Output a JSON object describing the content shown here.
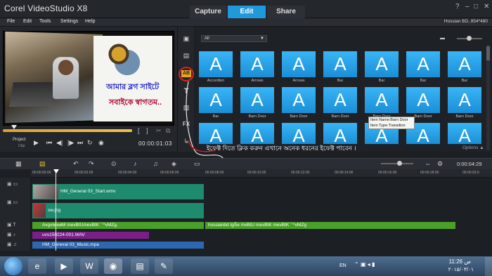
{
  "app": {
    "title": "Corel VideoStudio X8"
  },
  "tabs": [
    {
      "label": "Capture"
    },
    {
      "label": "Edit"
    },
    {
      "label": "Share"
    }
  ],
  "window_buttons": {
    "help": "?",
    "minimize": "–",
    "maximize": "□",
    "close": "✕"
  },
  "menu": [
    {
      "label": "File"
    },
    {
      "label": "Edit"
    },
    {
      "label": "Tools"
    },
    {
      "label": "Settings"
    },
    {
      "label": "Help"
    }
  ],
  "project_info": "Hossian BD, 854*480",
  "preview": {
    "overlay_line1": "আমার ব্লগ সাইটে",
    "overlay_line2": "সবাইকে স্বাগতম..",
    "project_label": "Project",
    "clip_label": "Clip",
    "timecode": "00:00:01:03",
    "progress": 1.0,
    "trim_start": "[",
    "trim_end": "]"
  },
  "library": {
    "category": "All",
    "transitions": [
      {
        "label": "Accordion"
      },
      {
        "label": "Arrows"
      },
      {
        "label": "Arrows"
      },
      {
        "label": "Bar"
      },
      {
        "label": "Bar"
      },
      {
        "label": "Bar"
      },
      {
        "label": "Bar"
      },
      {
        "label": "Bar"
      },
      {
        "label": "Barn Door"
      },
      {
        "label": "Barn Door"
      },
      {
        "label": "Barn Door"
      },
      {
        "label": "Barn Door"
      },
      {
        "label": "Barn Door"
      },
      {
        "label": "Barn Door"
      },
      {
        "label": ""
      },
      {
        "label": ""
      },
      {
        "label": ""
      },
      {
        "label": ""
      },
      {
        "label": ""
      },
      {
        "label": ""
      },
      {
        "label": ""
      }
    ],
    "thumb_glyph": "A",
    "tooltip_name": "Item Name:Barn Door",
    "tooltip_type": "Item Type:Transition",
    "options_label": "Options ▲"
  },
  "annotation": "ইফেক্ট দিতে ক্লিক করুন এখানে অনেক ধরনের ইফেক্ট পাবেন ।",
  "timeline": {
    "timecode": "0:00:04:29",
    "ticks": [
      "00:00:00:00",
      "00:00:02:00",
      "00:00:04:00",
      "00:00:06:00",
      "00:00:08:00",
      "00:00:10:00",
      "00:00:12:00",
      "00:00:14:00",
      "00:00:16:00",
      "00:00:18:00",
      "00:00:20:0"
    ],
    "clips": {
      "video": "HM_General 03_Start.wmv",
      "overlay": "sw.jpg",
      "title1": "AvgviweøM mevBtUmevBtK ¯^vMZg.",
      "title2": "hossianbd IgŠe mvBtU mevBtK mevBtK ¯^vMZg",
      "voice": "uvs150224-001.WAV",
      "music": "HM_General 03_Music.mpa"
    }
  },
  "taskbar": {
    "lang": "EN",
    "time": "11:26 ص",
    "date": "۲۰۱۵/۰۳/۰۱"
  },
  "colors": {
    "accent": "#1f98dc",
    "thumb": "#2aa4ec",
    "video_clip": "#1e8a6e",
    "title_clip": "#4aa028",
    "voice_clip": "#7a1f8a",
    "music_clip": "#2d67b0"
  }
}
